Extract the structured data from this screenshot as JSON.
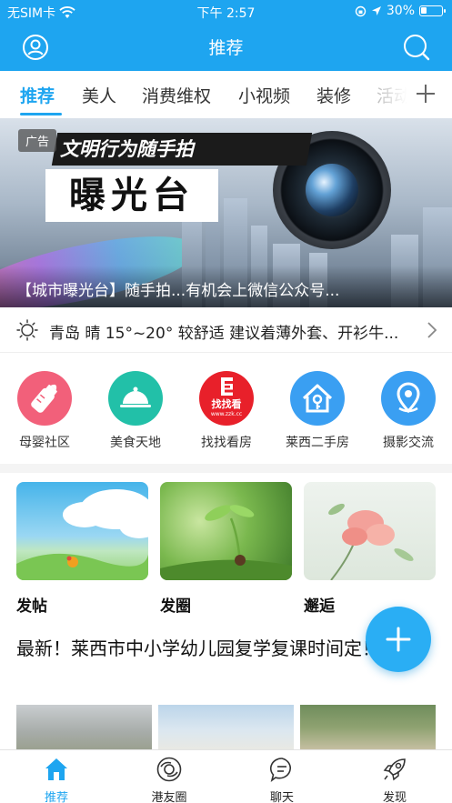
{
  "status_bar": {
    "carrier": "无SIM卡",
    "time": "下午 2:57",
    "battery": "30%"
  },
  "header": {
    "title": "推荐"
  },
  "tabs": [
    {
      "label": "推荐",
      "active": true
    },
    {
      "label": "美人"
    },
    {
      "label": "消费维权"
    },
    {
      "label": "小视频"
    },
    {
      "label": "装修"
    },
    {
      "label": "活动"
    }
  ],
  "banner": {
    "ad_tag": "广告",
    "slogan": "文明行为随手拍",
    "big_word": "曝光台",
    "caption": "【城市曝光台】随手拍...有机会上微信公众号..."
  },
  "weather": {
    "text": "青岛 晴 15°~20° 较舒适 建议着薄外套、开衫牛..."
  },
  "quick_links": [
    {
      "label": "母婴社区",
      "icon": "bottle-icon",
      "color": "#f2607a"
    },
    {
      "label": "美食天地",
      "icon": "food-cloche-icon",
      "color": "#22c0a8"
    },
    {
      "label": "找找看房",
      "icon": "zhaozhaokan-logo",
      "color": "#e8202a",
      "logo_text": "找找看",
      "logo_url": "www.zzk.cc"
    },
    {
      "label": "莱西二手房",
      "icon": "house-key-icon",
      "color": "#3a9ff2"
    },
    {
      "label": "摄影交流",
      "icon": "location-pin-icon",
      "color": "#3a9ff2"
    }
  ],
  "cards": [
    {
      "label": "发帖"
    },
    {
      "label": "发圈"
    },
    {
      "label": "邂逅"
    }
  ],
  "headline": "最新！莱西市中小学幼儿园复学复课时间定！",
  "bottom_nav": [
    {
      "label": "推荐",
      "icon": "home-icon",
      "active": true
    },
    {
      "label": "港友圈",
      "icon": "circle-moments-icon"
    },
    {
      "label": "聊天",
      "icon": "chat-icon"
    },
    {
      "label": "发现",
      "icon": "rocket-icon"
    }
  ],
  "colors": {
    "primary": "#1ea5f0"
  }
}
